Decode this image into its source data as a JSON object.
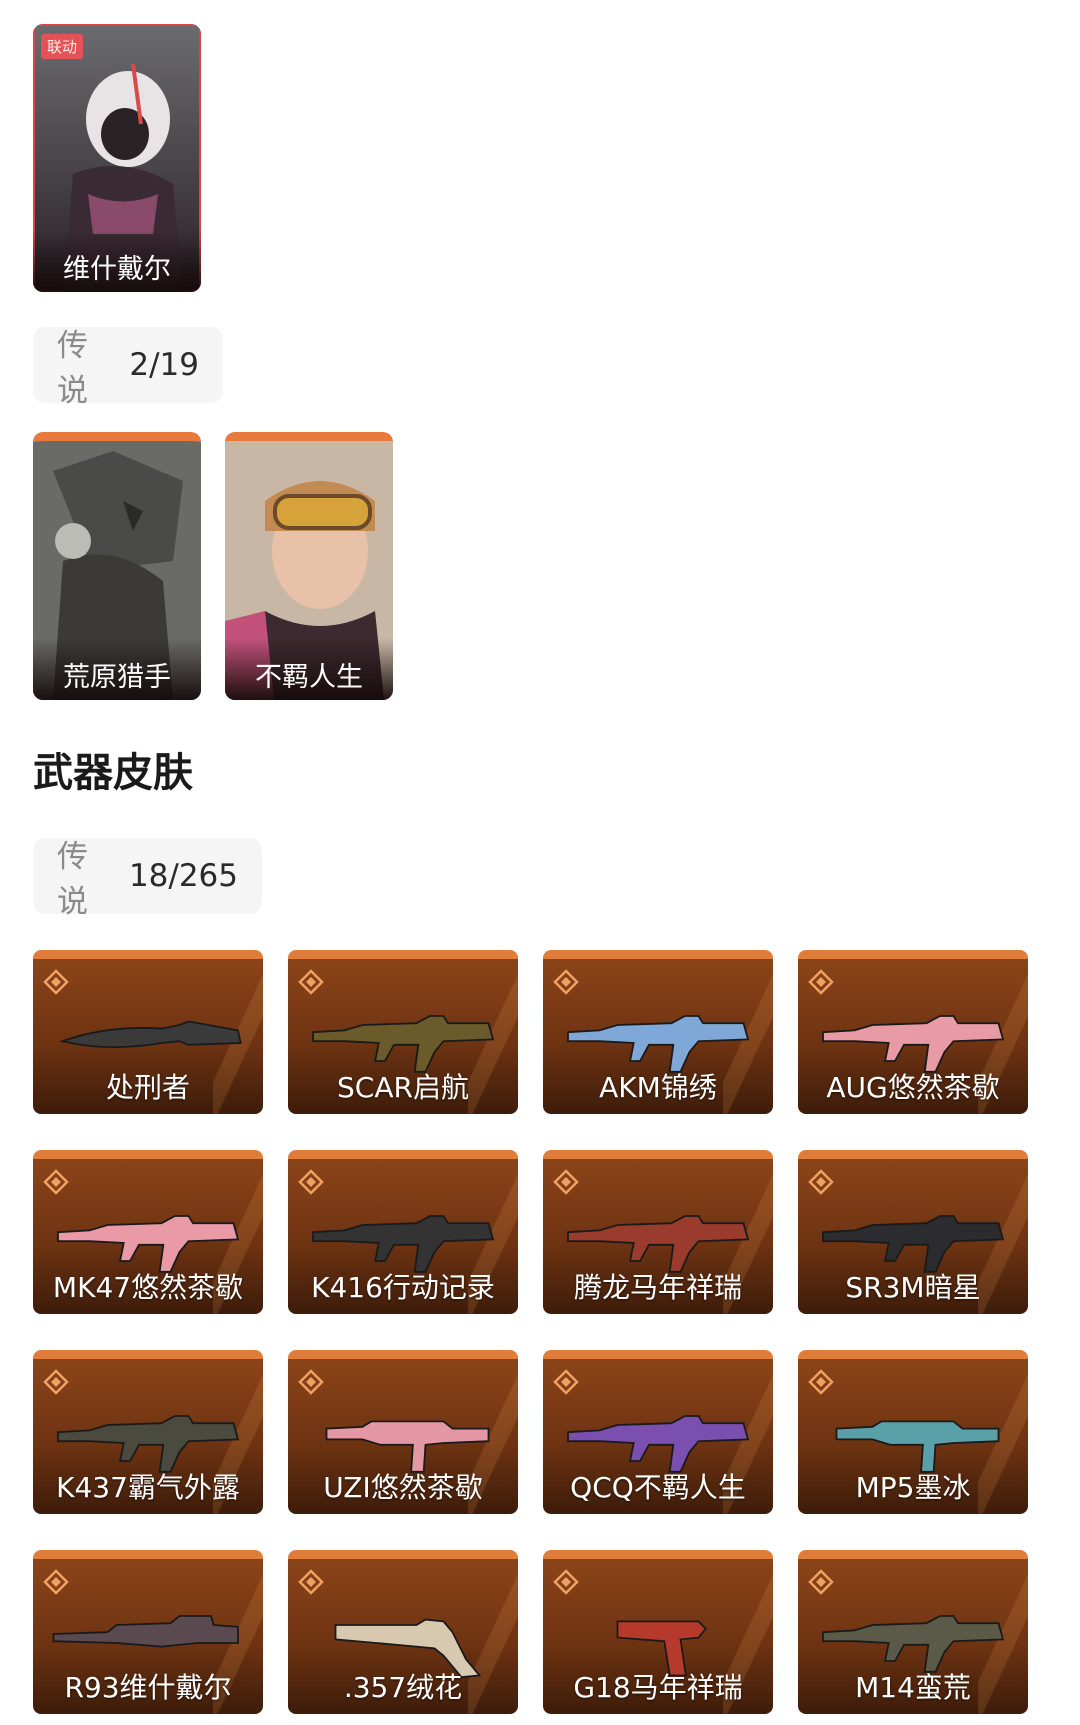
{
  "character_skins_top": [
    {
      "name": "维什戴尔",
      "tag": "联动"
    }
  ],
  "character_rarity": {
    "label": "传说",
    "count": "2/19"
  },
  "character_skins": [
    {
      "name": "荒原猎手"
    },
    {
      "name": "不羁人生"
    }
  ],
  "weapon_section": {
    "title": "武器皮肤"
  },
  "weapon_rarity": {
    "label": "传说",
    "count": "18/265"
  },
  "weapons": [
    {
      "name": "处刑者",
      "kind": "knife",
      "color": "#3a3a3a"
    },
    {
      "name": "SCAR启航",
      "kind": "rifle",
      "color": "#6b5a2a"
    },
    {
      "name": "AKM锦绣",
      "kind": "rifle",
      "color": "#7fa8d8"
    },
    {
      "name": "AUG悠然茶歇",
      "kind": "rifle",
      "color": "#e89aa5"
    },
    {
      "name": "MK47悠然茶歇",
      "kind": "rifle",
      "color": "#e99aa6"
    },
    {
      "name": "K416行动记录",
      "kind": "rifle",
      "color": "#333333"
    },
    {
      "name": "腾龙马年祥瑞",
      "kind": "rifle",
      "color": "#9a3b2e"
    },
    {
      "name": "SR3M暗星",
      "kind": "rifle",
      "color": "#2b2b30"
    },
    {
      "name": "K437霸气外露",
      "kind": "rifle",
      "color": "#4a4a3e"
    },
    {
      "name": "UZI悠然茶歇",
      "kind": "smg",
      "color": "#e497a4"
    },
    {
      "name": "QCQ不羁人生",
      "kind": "rifle",
      "color": "#7a4fb0"
    },
    {
      "name": "MP5墨冰",
      "kind": "smg",
      "color": "#5aa0a8"
    },
    {
      "name": "R93维什戴尔",
      "kind": "sniper",
      "color": "#5a4a50"
    },
    {
      "name": ".357绒花",
      "kind": "revolver",
      "color": "#d8c8b0"
    },
    {
      "name": "G18马年祥瑞",
      "kind": "pistol",
      "color": "#b53a2b"
    },
    {
      "name": "M14蛮荒",
      "kind": "rifle",
      "color": "#5b5a48"
    }
  ]
}
